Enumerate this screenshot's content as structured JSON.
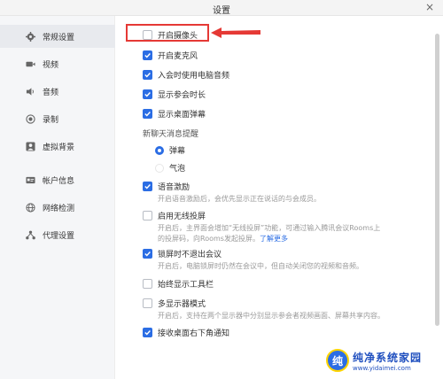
{
  "window": {
    "title": "设置",
    "close_glyph": "×"
  },
  "sidebar": {
    "items": [
      {
        "label": "常规设置",
        "icon": "gear-icon",
        "active": true
      },
      {
        "label": "视频",
        "icon": "video-camera-icon"
      },
      {
        "label": "音频",
        "icon": "speaker-icon"
      },
      {
        "label": "录制",
        "icon": "record-icon"
      },
      {
        "label": "虚拟背景",
        "icon": "person-icon"
      },
      {
        "label": "帐户信息",
        "icon": "account-card-icon"
      },
      {
        "label": "网络检测",
        "icon": "globe-icon"
      },
      {
        "label": "代理设置",
        "icon": "proxy-icon"
      }
    ]
  },
  "settings": {
    "enable_camera": {
      "label": "开启摄像头",
      "checked": false
    },
    "enable_mic": {
      "label": "开启麦克风",
      "checked": true
    },
    "use_pc_audio": {
      "label": "入会时使用电脑音频",
      "checked": true
    },
    "show_duration": {
      "label": "显示参会时长",
      "checked": true
    },
    "show_danmaku": {
      "label": "显示桌面弹幕",
      "checked": true
    },
    "chat_notify": {
      "label": "新聊天消息提醒",
      "options": [
        {
          "label": "弹幕",
          "selected": true
        },
        {
          "label": "气泡",
          "selected": false
        }
      ]
    },
    "voice_excitation": {
      "label": "语音激励",
      "checked": true,
      "desc": "开启语音激励后，会优先显示正在说话的与会成员。"
    },
    "wireless_cast": {
      "label": "启用无线投屏",
      "checked": false,
      "desc_line1": "开启后，主界面会增加“无线投屏”功能，可通过输入腾讯会议Rooms上",
      "desc_line2": "的投屏码，向Rooms发起投屏。",
      "link": "了解更多"
    },
    "lock_screen": {
      "label": "锁屏时不退出会议",
      "checked": true,
      "desc": "开启后，电脑锁屏时仍然在会议中，但自动关闭您的视频和音频。"
    },
    "always_toolbar": {
      "label": "始终显示工具栏",
      "checked": false
    },
    "multi_display": {
      "label": "多显示器模式",
      "checked": false,
      "desc": "开启后，支持在两个显示器中分别显示参会者视频画面、屏幕共享内容。"
    },
    "desktop_notify": {
      "label": "接收桌面右下角通知",
      "checked": true
    }
  },
  "watermark": {
    "logo_glyph": "纯",
    "title": "纯净系统家园",
    "url": "www.yidaimei.com"
  },
  "colors": {
    "accent": "#2b6de4",
    "highlight": "#e53935"
  }
}
